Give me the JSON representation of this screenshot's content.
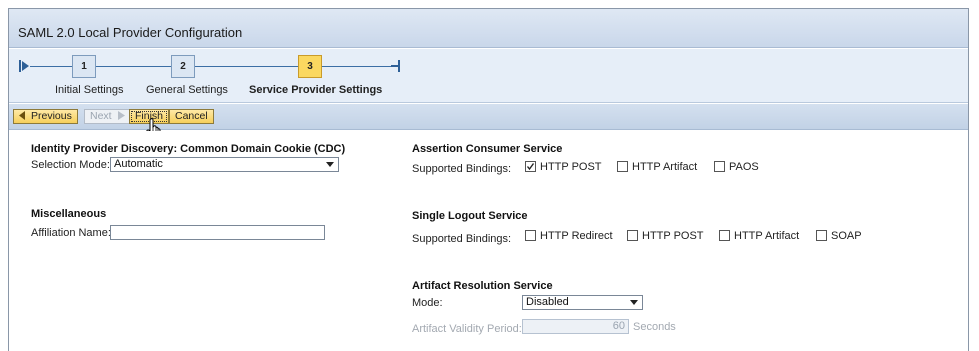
{
  "window": {
    "title": "SAML 2.0 Local Provider Configuration"
  },
  "roadmap": {
    "steps": [
      {
        "number": "1",
        "label": "Initial Settings",
        "active": false
      },
      {
        "number": "2",
        "label": "General Settings",
        "active": false
      },
      {
        "number": "3",
        "label": "Service Provider Settings",
        "active": true
      }
    ]
  },
  "toolbar": {
    "previous_label": "Previous",
    "next_label": "Next",
    "finish_label": "Finish",
    "cancel_label": "Cancel"
  },
  "idp_discovery": {
    "title": "Identity Provider Discovery: Common Domain Cookie (CDC)",
    "selection_mode_label": "Selection Mode:",
    "selection_mode_value": "Automatic"
  },
  "miscellaneous": {
    "title": "Miscellaneous",
    "affiliation_name_label": "Affiliation Name:",
    "affiliation_name_value": ""
  },
  "assertion_consumer_service": {
    "title": "Assertion Consumer Service",
    "bindings_label": "Supported Bindings:",
    "bindings": [
      {
        "label": "HTTP POST",
        "checked": true
      },
      {
        "label": "HTTP Artifact",
        "checked": false
      },
      {
        "label": "PAOS",
        "checked": false
      }
    ]
  },
  "single_logout_service": {
    "title": "Single Logout Service",
    "bindings_label": "Supported Bindings:",
    "bindings": [
      {
        "label": "HTTP Redirect",
        "checked": false
      },
      {
        "label": "HTTP POST",
        "checked": false
      },
      {
        "label": "HTTP Artifact",
        "checked": false
      },
      {
        "label": "SOAP",
        "checked": false
      }
    ]
  },
  "artifact_resolution_service": {
    "title": "Artifact Resolution Service",
    "mode_label": "Mode:",
    "mode_value": "Disabled",
    "validity_label": "Artifact Validity Period:",
    "validity_value": "60",
    "validity_unit": "Seconds"
  },
  "icons": {
    "road_start": "roadmap-start-icon",
    "road_end": "roadmap-end-icon",
    "cursor": "hand-pointer-cursor-icon"
  }
}
